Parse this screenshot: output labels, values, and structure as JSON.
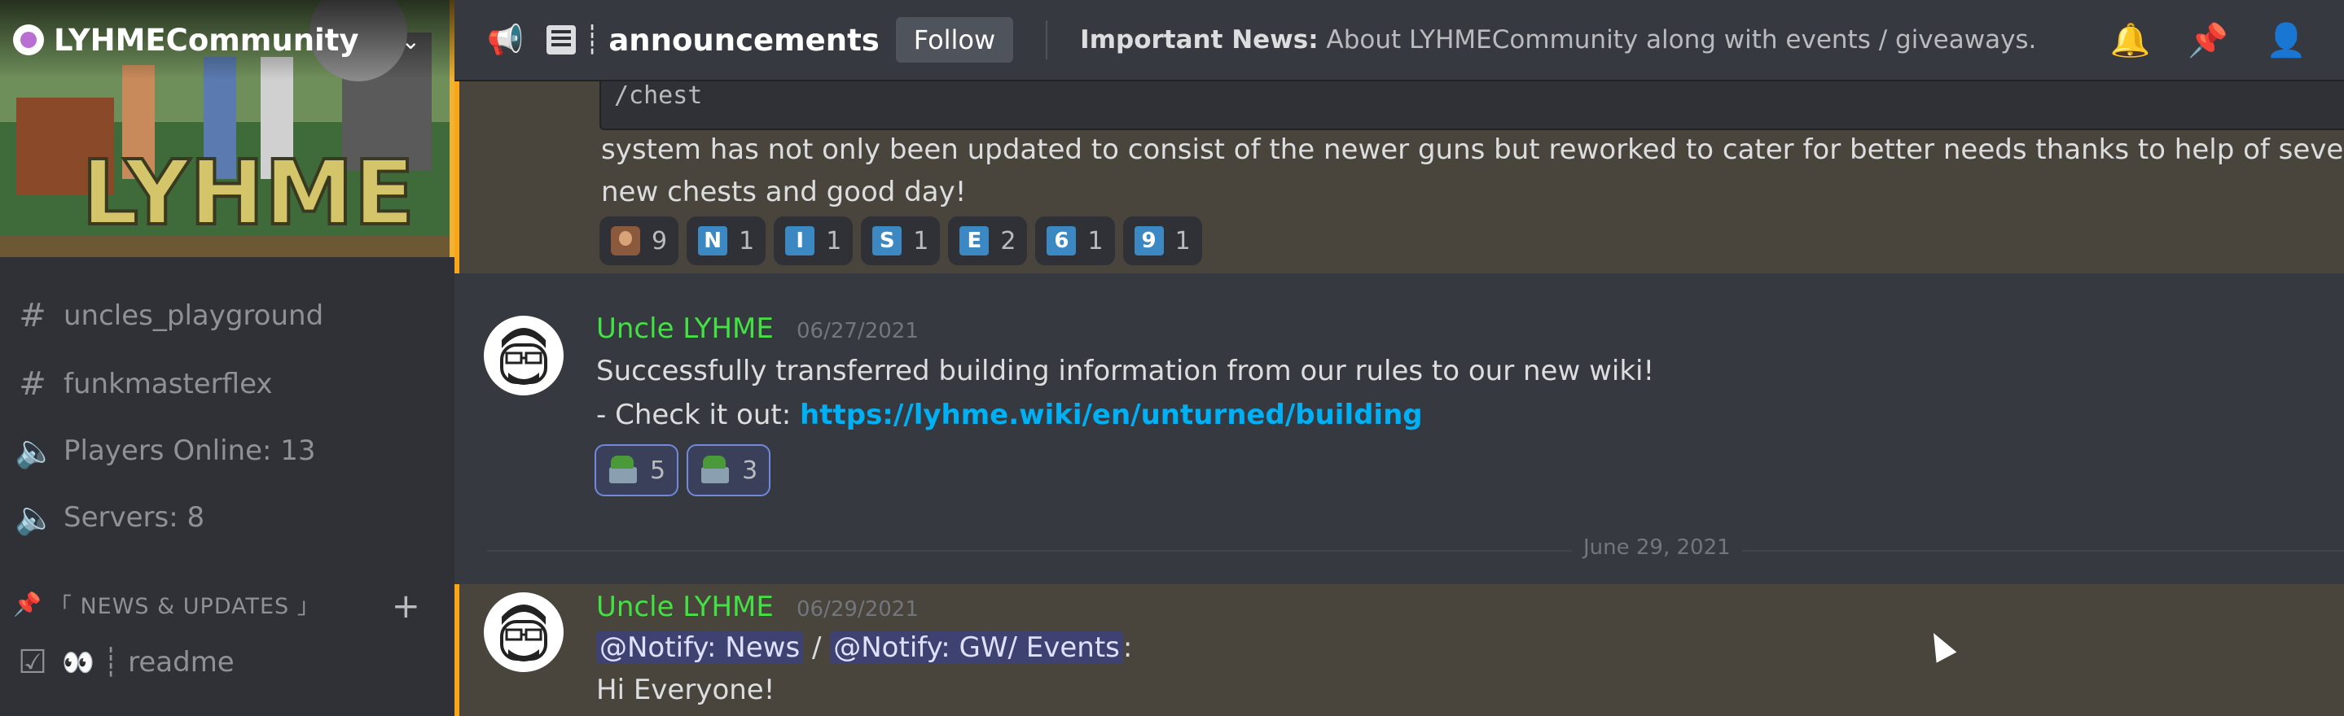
{
  "server": {
    "name": "LYHMECommunity",
    "banner_text": "LYHME"
  },
  "sidebar": {
    "channels": [
      {
        "icon": "hash-icon",
        "label": "uncles_playground"
      },
      {
        "icon": "hash-icon",
        "label": "funkmasterflex"
      },
      {
        "icon": "speaker-icon",
        "label": "Players Online: 13"
      },
      {
        "icon": "speaker-icon",
        "label": "Servers: 8"
      }
    ],
    "category": {
      "label": "「 NEWS & UPDATES 」"
    },
    "readme": {
      "eyes": "👀",
      "label": "┊ readme"
    }
  },
  "topbar": {
    "channel_name": "announcements",
    "bar_glyph": "┊",
    "follow_label": "Follow",
    "topic_bold": "Important News:",
    "topic_rest": " About LYHMECommunity along with events / giveaways."
  },
  "messages": {
    "first": {
      "code": "/chest",
      "line1": " system has not only been updated to consist of the newer guns but reworked to cater for better needs thanks to help of several individ",
      "line2": "new chests and good day!",
      "reactions": [
        {
          "emoji": "face-emoji",
          "count": "9"
        },
        {
          "letter": "N",
          "count": "1"
        },
        {
          "letter": "I",
          "count": "1"
        },
        {
          "letter": "S",
          "count": "1"
        },
        {
          "letter": "E",
          "count": "2"
        },
        {
          "letter": "6",
          "count": "1"
        },
        {
          "letter": "9",
          "count": "1"
        }
      ]
    },
    "second": {
      "author": "Uncle LYHME",
      "timestamp": "06/27/2021",
      "line1": "Successfully transferred building information from our rules to our new wiki!",
      "line2_prefix": "- Check it out: ",
      "link": "https://lyhme.wiki/en/unturned/building",
      "reactions": [
        {
          "emoji": "house-emoji",
          "count": "5"
        },
        {
          "emoji": "house-emoji",
          "count": "3"
        }
      ]
    },
    "date_separator": "June 29, 2021",
    "third": {
      "author": "Uncle LYHME",
      "timestamp": "06/29/2021",
      "mention1": "@Notify: News",
      "separator": " / ",
      "mention2": "@Notify: GW/ Events",
      "colon": ":",
      "line2": "Hi Everyone!"
    }
  },
  "colors": {
    "background": "#36393f",
    "sidebar": "#2f3136",
    "author": "#43e143",
    "link": "#00b0f4",
    "highlight": "#49443c",
    "highlight_bar": "#faa61a"
  }
}
